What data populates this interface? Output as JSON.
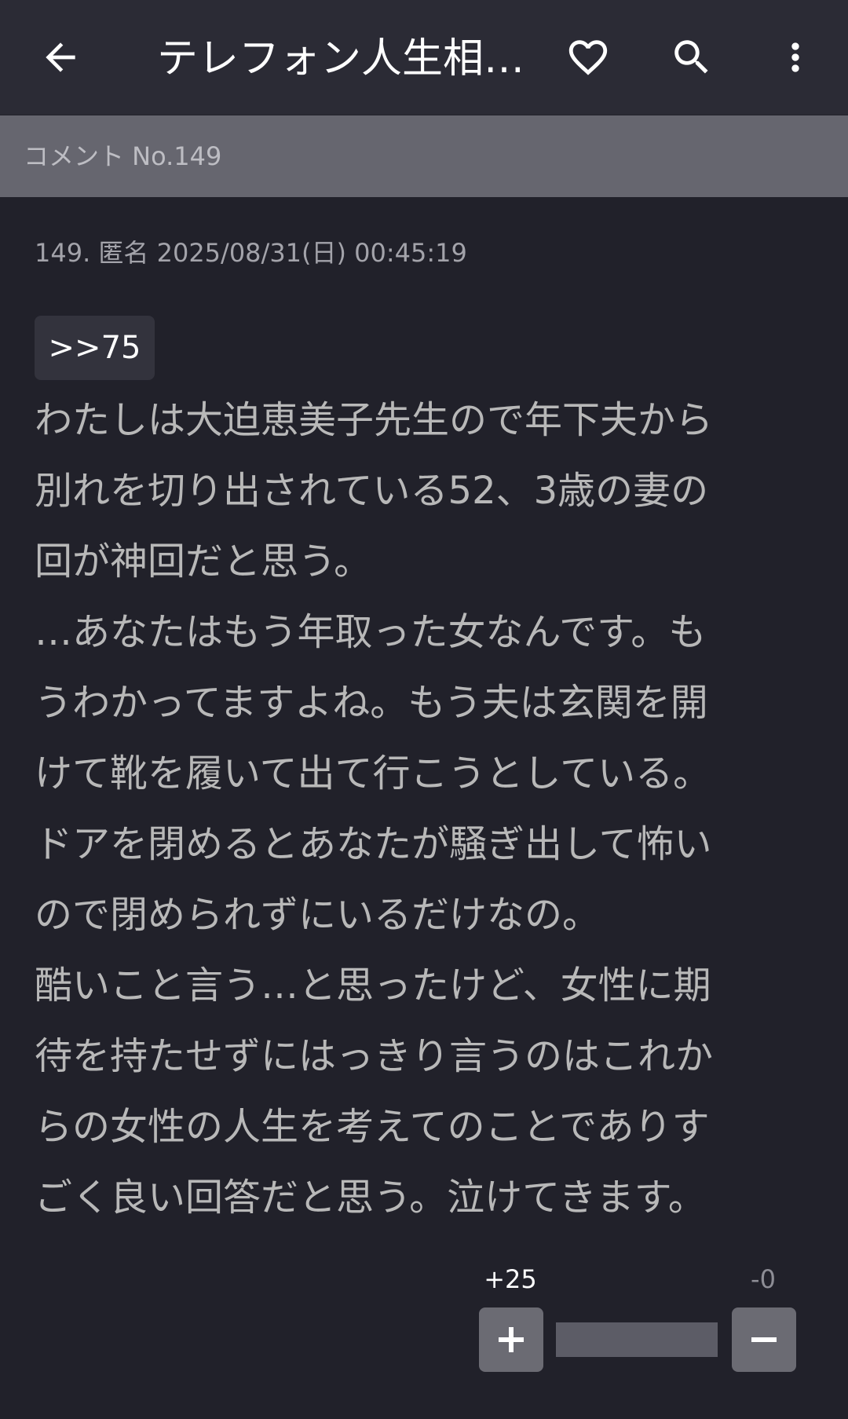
{
  "app_bar": {
    "title": "テレフォン人生相…",
    "back_icon": "arrow-left-icon",
    "favorite_icon": "heart-outline-icon",
    "search_icon": "search-icon",
    "more_icon": "more-vert-icon"
  },
  "subheader": {
    "label": "コメント No.149"
  },
  "comment": {
    "meta": "149. 匿名 2025/08/31(日) 00:45:19",
    "anchor": ">>75",
    "lines": [
      "わたしは大迫恵美子先生ので年下夫から",
      "別れを切り出されている52、3歳の妻の",
      "回が神回だと思う。",
      "…あなたはもう年取った女なんです。も",
      "うわかってますよね。もう夫は玄関を開",
      "けて靴を履いて出て行こうとしている。",
      "ドアを閉めるとあなたが騒ぎ出して怖い",
      "ので閉められずにいるだけなの。",
      "酷いこと言う…と思ったけど、女性に期",
      "待を持たせずにはっきり言うのはこれか",
      "らの女性の人生を考えてのことでありす",
      "ごく良い回答だと思う。泣けてきます。"
    ]
  },
  "votes": {
    "plus_count": "+25",
    "minus_count": "-0",
    "plus_icon": "plus-icon",
    "minus_icon": "minus-icon",
    "plus_ratio": 1.0
  },
  "colors": {
    "background": "#21212a",
    "app_bar": "#2b2b35",
    "subheader": "#66666f",
    "body_text": "#b8b8b8",
    "vote_button": "#6b6b73"
  }
}
